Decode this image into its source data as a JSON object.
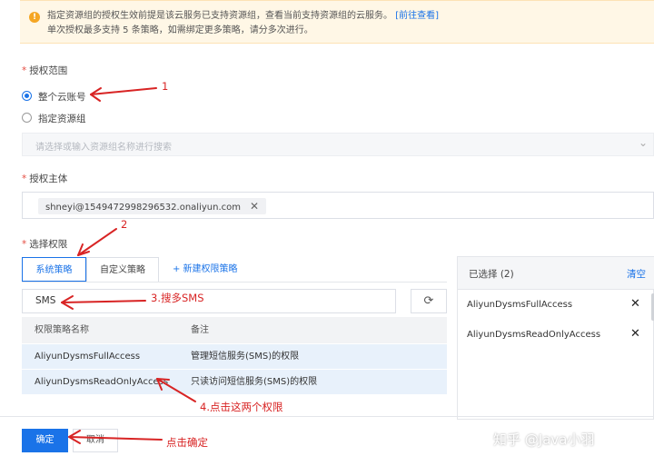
{
  "notice": {
    "line1": "指定资源组的授权生效前提是该云服务已支持资源组，查看当前支持资源组的云服务。",
    "link": "[前往查看]",
    "line2": "单次授权最多支持 5 条策略，如需绑定更多策略，请分多次进行。"
  },
  "scope": {
    "label": "授权范围",
    "options": [
      {
        "label": "整个云账号",
        "checked": true
      },
      {
        "label": "指定资源组",
        "checked": false
      }
    ],
    "resource_group_placeholder": "请选择或输入资源组名称进行搜索"
  },
  "principal": {
    "label": "授权主体",
    "tag": "shneyi@1549472998296532.onaliyun.com"
  },
  "permissions": {
    "label": "选择权限",
    "tabs": [
      "系统策略",
      "自定义策略"
    ],
    "new_policy": "+ 新建权限策略",
    "search_value": "SMS",
    "table": {
      "headers": [
        "权限策略名称",
        "备注"
      ],
      "rows": [
        {
          "name": "AliyunDysmsFullAccess",
          "note": "管理短信服务(SMS)的权限"
        },
        {
          "name": "AliyunDysmsReadOnlyAccess",
          "note": "只读访问短信服务(SMS)的权限"
        }
      ]
    }
  },
  "selected": {
    "title": "已选择 (2)",
    "clear": "清空",
    "items": [
      "AliyunDysmsFullAccess",
      "AliyunDysmsReadOnlyAccess"
    ]
  },
  "footer": {
    "ok": "确定",
    "cancel": "取消"
  },
  "annotations": {
    "a1": "1",
    "a2": "2",
    "a3": "3.搜多SMS",
    "a4": "4.点击这两个权限",
    "a5": "点击确定"
  },
  "watermark": "知乎 @Java小羽",
  "colors": {
    "accent": "#1a73e8",
    "annotation": "#d82424",
    "notice_bg": "#fff7e6"
  }
}
